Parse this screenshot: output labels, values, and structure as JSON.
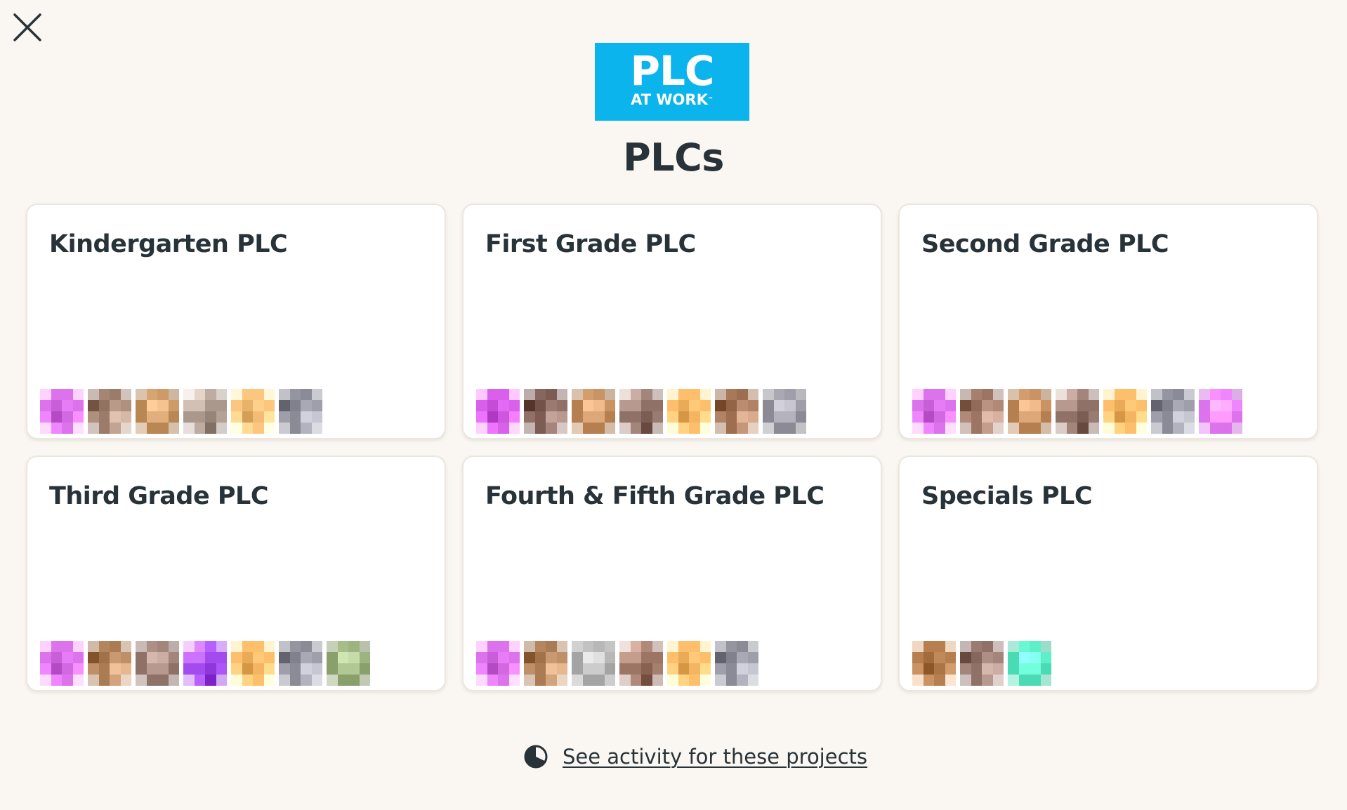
{
  "close": {
    "icon": "close-icon"
  },
  "logo": {
    "main": "PLC",
    "sub": "AT WORK",
    "tm": "™",
    "bg_color": "#0bb4ec"
  },
  "page": {
    "title": "PLCs"
  },
  "cards": [
    {
      "title": "Kindergarten PLC",
      "avatar_colors": [
        "#d873e8",
        "#9a7b6b",
        "#b68757",
        "#a9988e",
        "#fbc683",
        "#8a8b96"
      ]
    },
    {
      "title": "First Grade PLC",
      "avatar_colors": [
        "#d562e6",
        "#7c5c54",
        "#b37f52",
        "#8f7168",
        "#fbbf71",
        "#9c6e52",
        "#8c8a95"
      ]
    },
    {
      "title": "Second Grade PLC",
      "avatar_colors": [
        "#d873e8",
        "#9a7566",
        "#b37f52",
        "#8f7168",
        "#fbbf71",
        "#8a8b96",
        "#d873e8"
      ]
    },
    {
      "title": "Third Grade PLC",
      "avatar_colors": [
        "#d873e8",
        "#a97b55",
        "#8f7168",
        "#a04ce8",
        "#fbbf71",
        "#8a8b96",
        "#8aa06e"
      ]
    },
    {
      "title": "Fourth & Fifth Grade PLC",
      "avatar_colors": [
        "#d873e8",
        "#a97b55",
        "#a4a4a4",
        "#9a7566",
        "#fbbf71",
        "#8a8b96"
      ]
    },
    {
      "title": "Specials PLC",
      "avatar_colors": [
        "#b37f52",
        "#8f7168",
        "#4fd8b4"
      ]
    }
  ],
  "activity": {
    "icon": "pie-chart-icon",
    "link": "See activity for these projects"
  }
}
